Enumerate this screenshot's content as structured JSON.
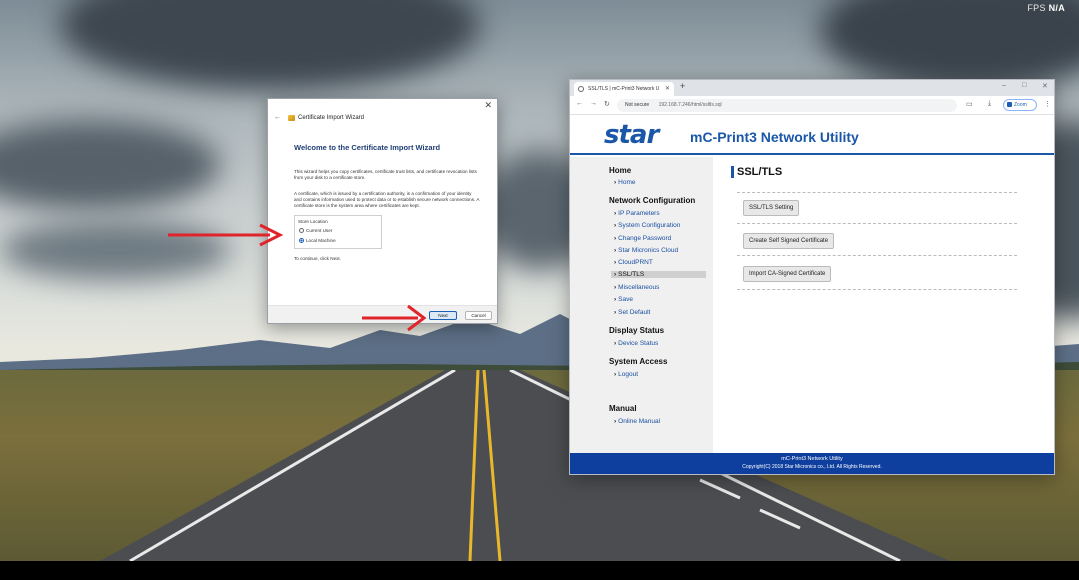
{
  "overlay": {
    "fps_label": "FPS",
    "fps_value": "N/A"
  },
  "wizard": {
    "title": "Certificate Import Wizard",
    "heading": "Welcome to the Certificate Import Wizard",
    "para1": "This wizard helps you copy certificates, certificate trust lists, and certificate revocation lists from your disk to a certificate store.",
    "para2": "A certificate, which is issued by a certification authority, is a confirmation of your identity and contains information used to protect data or to establish secure network connections. A certificate store is the system area where certificates are kept.",
    "store_location_label": "Store Location",
    "option_current_user": "Current User",
    "option_local_machine": "Local Machine",
    "selected_option": "Local Machine",
    "continue_text": "To continue, click Next.",
    "next_label": "Next",
    "cancel_label": "Cancel",
    "arrow_color": "#e0242b"
  },
  "browser": {
    "tab_title": "SSL/TLS | mC-Print3 Network U",
    "not_secure": "Not secure",
    "url": "192.168.7.246/html/ssltls.sql",
    "zoom_label": "Zoom"
  },
  "page": {
    "logo": "star",
    "product_title": "mC-Print3 Network Utility",
    "brand_color": "#1a57a8",
    "sidebar": {
      "home_header": "Home",
      "home_link": "Home",
      "netconf_header": "Network Configuration",
      "netconf_links": [
        "IP Parameters",
        "System Configuration",
        "Change Password",
        "Star Micronics Cloud",
        "CloudPRNT",
        "SSL/TLS",
        "Miscellaneous",
        "Save",
        "Set Default"
      ],
      "active_link": "SSL/TLS",
      "display_header": "Display Status",
      "display_link": "Device Status",
      "access_header": "System Access",
      "access_link": "Logout",
      "manual_header": "Manual",
      "manual_link": "Online Manual"
    },
    "section_title": "SSL/TLS",
    "buttons": {
      "setting": "SSL/TLS Setting",
      "self_signed": "Create Self Signed Certificate",
      "ca_signed": "Import CA-Signed Certificate"
    },
    "footer_line1": "mC-Print3 Network Utility",
    "footer_line2": "Copyright(C) 2018 Star Micronics co., Ltd. All Rights Reserved."
  }
}
